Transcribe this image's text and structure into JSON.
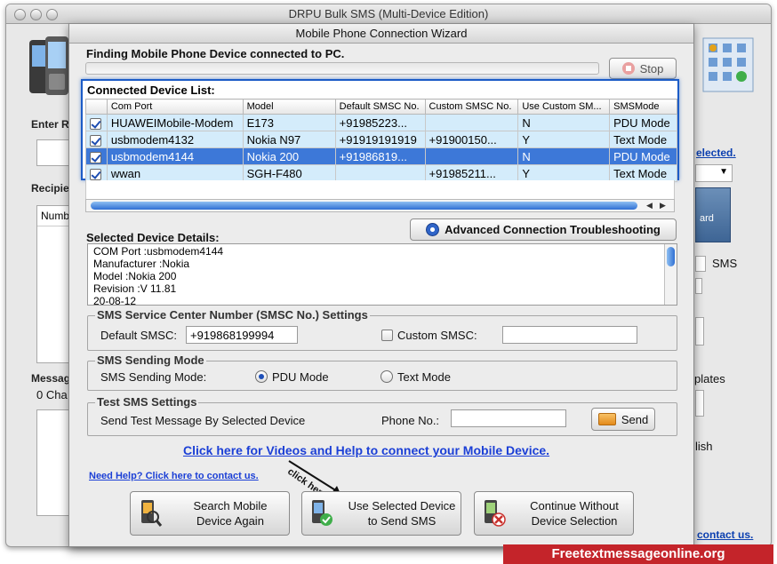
{
  "main_window": {
    "title": "DRPU Bulk SMS (Multi-Device Edition)",
    "bg": {
      "enter_label": "Enter Re",
      "recipient_label": "Recipie",
      "number_col": "Numb",
      "message_label": "Messag",
      "char_count": "0 Cha",
      "selected_link": "elected.",
      "sms_label": "SMS",
      "templates_label": "plates",
      "english_label": "lish",
      "contact_link": "contact us.",
      "wizard_btn_text": "ard"
    }
  },
  "wizard": {
    "title": "Mobile Phone Connection Wizard",
    "finding_heading": "Finding Mobile Phone Device connected to PC.",
    "stop_label": "Stop",
    "device_list_title": "Connected Device List:",
    "columns": [
      "Com Port",
      "Model",
      "Default SMSC No.",
      "Custom SMSC No.",
      "Use Custom SM...",
      "SMSMode"
    ],
    "devices": [
      {
        "com_port": "HUAWEIMobile-Modem",
        "model": "E173",
        "default_smsc": "+91985223...",
        "custom_smsc": "",
        "use_custom": "N",
        "mode": "PDU Mode",
        "selected": false
      },
      {
        "com_port": "usbmodem4132",
        "model": "Nokia N97",
        "default_smsc": "+91919191919",
        "custom_smsc": "+91900150...",
        "use_custom": "Y",
        "mode": "Text Mode",
        "selected": false
      },
      {
        "com_port": "usbmodem4144",
        "model": "Nokia 200",
        "default_smsc": "+91986819...",
        "custom_smsc": "",
        "use_custom": "N",
        "mode": "PDU Mode",
        "selected": true
      },
      {
        "com_port": "wwan",
        "model": "SGH-F480",
        "default_smsc": "",
        "custom_smsc": "+91985211...",
        "use_custom": "Y",
        "mode": "Text Mode",
        "selected": false
      }
    ],
    "advanced_btn": "Advanced Connection Troubleshooting",
    "details_heading": "Selected Device Details:",
    "details_lines": [
      "COM Port :usbmodem4144",
      "Manufacturer :Nokia",
      "Model :Nokia 200",
      "Revision :V 11.81",
      "20-08-12"
    ],
    "smsc_group": {
      "title": "SMS Service Center Number (SMSC No.) Settings",
      "default_label": "Default SMSC:",
      "default_value": "+919868199994",
      "custom_label": "Custom SMSC:",
      "custom_value": ""
    },
    "mode_group": {
      "title": "SMS Sending Mode",
      "label": "SMS Sending Mode:",
      "pdu": "PDU Mode",
      "text": "Text Mode"
    },
    "test_group": {
      "title": "Test SMS Settings",
      "label": "Send Test Message By Selected Device",
      "phone_label": "Phone No.:",
      "phone_value": "",
      "send": "Send"
    },
    "videos_link": "Click here for Videos and Help to connect your Mobile Device.",
    "help_link": "Need Help? Click here to contact us.",
    "click_here": "click here",
    "buttons": {
      "search": [
        "Search Mobile",
        "Device Again"
      ],
      "use": [
        "Use Selected Device",
        "to Send SMS"
      ],
      "continue": [
        "Continue Without",
        "Device Selection"
      ]
    }
  },
  "brand": "Freetextmessageonline.org",
  "colors": {
    "selection": "#3d78d8",
    "row": "#d4ecfb",
    "link": "#1b3fd6",
    "brand": "#c4242a"
  }
}
